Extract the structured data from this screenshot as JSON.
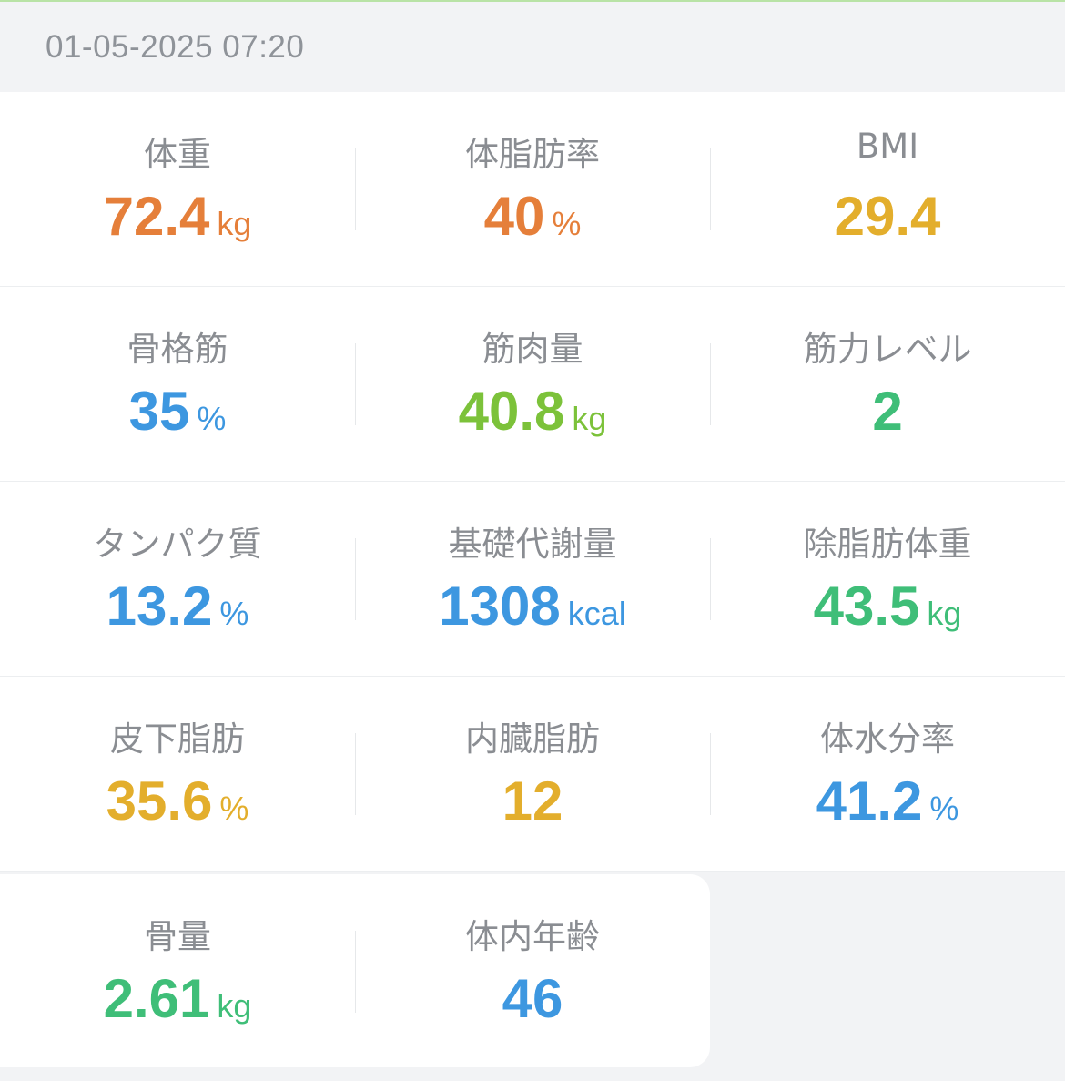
{
  "timestamp": "01-05-2025 07:20",
  "colors": {
    "orange": "#e57f3a",
    "yellow": "#e3ae2c",
    "blue": "#3d97e0",
    "lime": "#7cc23a",
    "green": "#3fbe78"
  },
  "metrics": [
    {
      "label": "体重",
      "value": "72.4",
      "unit": "kg",
      "color": "#e57f3a"
    },
    {
      "label": "体脂肪率",
      "value": "40",
      "unit": "%",
      "color": "#e57f3a"
    },
    {
      "label": "BMI",
      "value": "29.4",
      "unit": "",
      "color": "#e3ae2c"
    },
    {
      "label": "骨格筋",
      "value": "35",
      "unit": "%",
      "color": "#3d97e0"
    },
    {
      "label": "筋肉量",
      "value": "40.8",
      "unit": "kg",
      "color": "#7cc23a"
    },
    {
      "label": "筋力レベル",
      "value": "2",
      "unit": "",
      "color": "#3fbe78"
    },
    {
      "label": "タンパク質",
      "value": "13.2",
      "unit": "%",
      "color": "#3d97e0"
    },
    {
      "label": "基礎代謝量",
      "value": "1308",
      "unit": "kcal",
      "color": "#3d97e0"
    },
    {
      "label": "除脂肪体重",
      "value": "43.5",
      "unit": "kg",
      "color": "#3fbe78"
    },
    {
      "label": "皮下脂肪",
      "value": "35.6",
      "unit": "%",
      "color": "#e3ae2c"
    },
    {
      "label": "内臓脂肪",
      "value": "12",
      "unit": "",
      "color": "#e3ae2c"
    },
    {
      "label": "体水分率",
      "value": "41.2",
      "unit": "%",
      "color": "#3d97e0"
    },
    {
      "label": "骨量",
      "value": "2.61",
      "unit": "kg",
      "color": "#3fbe78"
    },
    {
      "label": "体内年齢",
      "value": "46",
      "unit": "",
      "color": "#3d97e0"
    }
  ]
}
